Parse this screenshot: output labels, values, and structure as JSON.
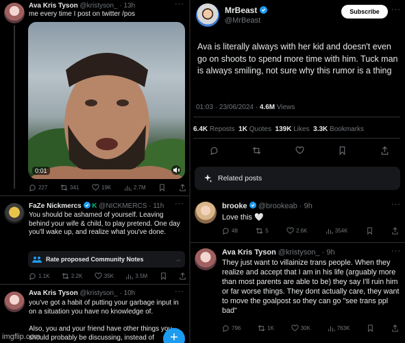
{
  "left": {
    "post1": {
      "name": "Ava Kris Tyson",
      "handle": "@kristyson_",
      "time": "· 13h",
      "text": "me every time I post on twitter /pos",
      "video_time": "0:01",
      "actions": {
        "replies": "227",
        "reposts": "341",
        "likes": "19K",
        "views": "2.7M"
      }
    },
    "post2": {
      "name": "FaZe Nickmercs",
      "handle": "@NICKMERCS",
      "time": "· 11h",
      "text": "You should be ashamed of yourself. Leaving behind your wife & child, to play pretend. One day you'll wake up, and realize what you've done.",
      "community_notes": "Rate proposed Community Notes",
      "actions": {
        "replies": "1.1K",
        "reposts": "2.2K",
        "likes": "35K",
        "views": "3.5M"
      }
    },
    "post3": {
      "name": "Ava Kris Tyson",
      "handle": "@kristyson_",
      "time": "· 10h",
      "text1": "you've got a habit of putting your garbage input in on a situation you have no knowledge of.",
      "text2": "Also, you and your friend have other things you should probably be discussing, instead of"
    },
    "watermark": "imgflip.com"
  },
  "right": {
    "main": {
      "name": "MrBeast",
      "handle": "@MrBeast",
      "subscribe": "Subscribe",
      "text": "Ava is literally always with her kid and doesn't even go on shoots to spend more time with him. Tuck man is always smiling, not sure why this rumor is a thing",
      "timestamp": "01:03 · 23/06/2024 · ",
      "views_num": "4.6M",
      "views_label": " Views",
      "stats": [
        {
          "num": "6.4K",
          "label": " Reposts"
        },
        {
          "num": "1K",
          "label": " Quotes"
        },
        {
          "num": "139K",
          "label": " Likes"
        },
        {
          "num": "3.3K",
          "label": " Bookmarks"
        }
      ],
      "related": "Related posts"
    },
    "reply1": {
      "name": "brooke",
      "handle": "@brookeab",
      "time": "· 9h",
      "text": "Love this 🤍",
      "actions": {
        "replies": "48",
        "reposts": "5",
        "likes": "2.6K",
        "views": "354K"
      }
    },
    "reply2": {
      "name": "Ava Kris Tyson",
      "handle": "@kristyson_",
      "time": "· 9h",
      "text": "They just want to villainize trans people. When they realize and accept that I am in his life (arguably more than most parents are able to be) they say I'll ruin him or far worse things. They dont actually care, they want to move the goalpost so they can go \"see trans ppl bad\"",
      "actions": {
        "replies": "796",
        "reposts": "1K",
        "likes": "30K",
        "views": "763K"
      }
    }
  },
  "colors": {
    "accent": "#1d9bf0",
    "green": "#00ba7c",
    "bg": "#000000",
    "muted": "#71767b"
  }
}
